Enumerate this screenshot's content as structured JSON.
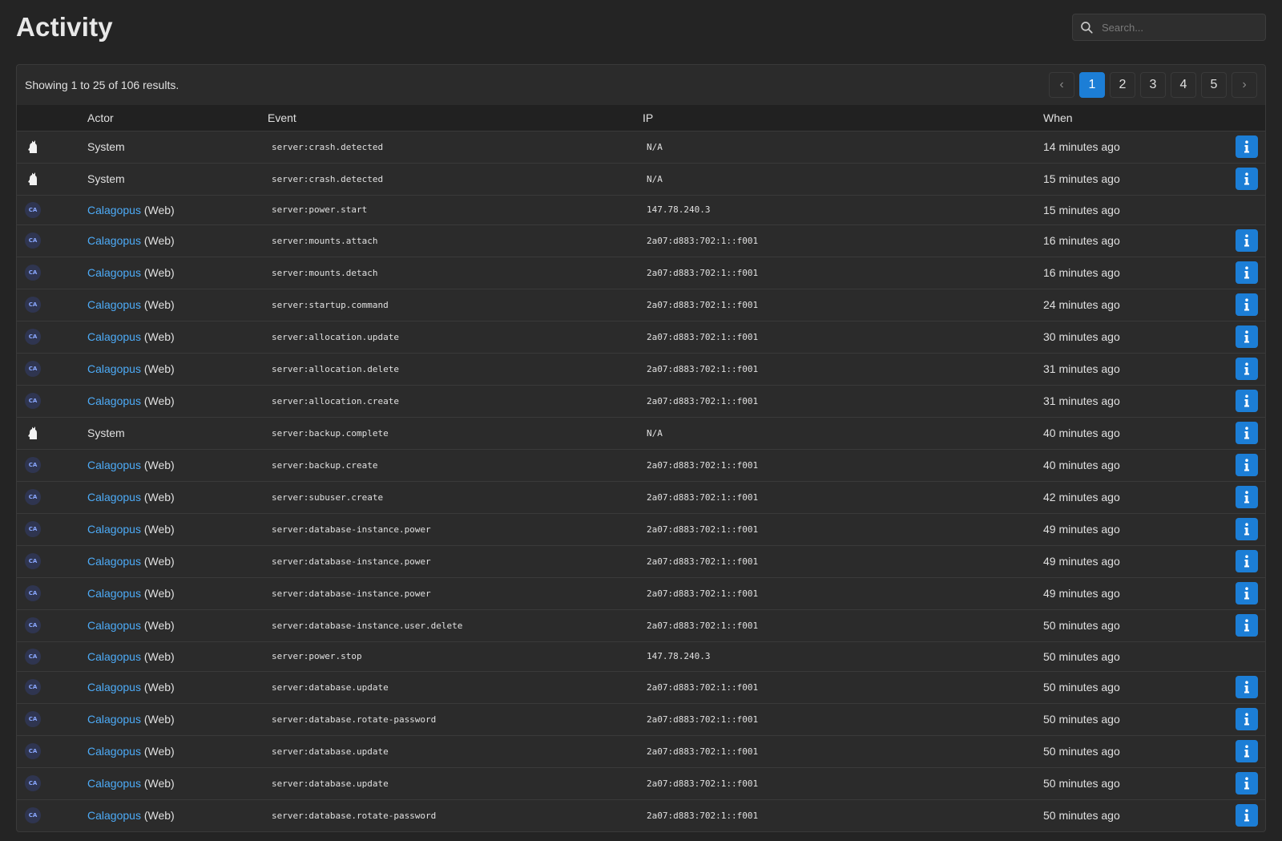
{
  "page": {
    "title": "Activity",
    "search_placeholder": "Search..."
  },
  "results": "Showing 1 to 25 of 106 results.",
  "pagination": {
    "prev": "‹",
    "next": "›",
    "pages": [
      "1",
      "2",
      "3",
      "4",
      "5"
    ],
    "current": "1"
  },
  "columns": [
    "Actor",
    "Event",
    "IP",
    "When"
  ],
  "colors": {
    "background": "#242424",
    "panel": "#2b2b2b",
    "accent": "#1c7ed6",
    "link": "#4dabf7"
  },
  "rows": [
    {
      "kind": "system",
      "actor": "System",
      "event": "server:crash.detected",
      "ip": "N/A",
      "when": "14 minutes ago",
      "info": true
    },
    {
      "kind": "system",
      "actor": "System",
      "event": "server:crash.detected",
      "ip": "N/A",
      "when": "15 minutes ago",
      "info": true
    },
    {
      "kind": "user",
      "avatar": "CA",
      "actor": "Calagopus",
      "suffix": " (Web)",
      "event": "server:power.start",
      "ip": "147.78.240.3",
      "when": "15 minutes ago",
      "info": false
    },
    {
      "kind": "user",
      "avatar": "CA",
      "actor": "Calagopus",
      "suffix": " (Web)",
      "event": "server:mounts.attach",
      "ip": "2a07:d883:702:1::f001",
      "when": "16 minutes ago",
      "info": true
    },
    {
      "kind": "user",
      "avatar": "CA",
      "actor": "Calagopus",
      "suffix": " (Web)",
      "event": "server:mounts.detach",
      "ip": "2a07:d883:702:1::f001",
      "when": "16 minutes ago",
      "info": true
    },
    {
      "kind": "user",
      "avatar": "CA",
      "actor": "Calagopus",
      "suffix": " (Web)",
      "event": "server:startup.command",
      "ip": "2a07:d883:702:1::f001",
      "when": "24 minutes ago",
      "info": true
    },
    {
      "kind": "user",
      "avatar": "CA",
      "actor": "Calagopus",
      "suffix": " (Web)",
      "event": "server:allocation.update",
      "ip": "2a07:d883:702:1::f001",
      "when": "30 minutes ago",
      "info": true
    },
    {
      "kind": "user",
      "avatar": "CA",
      "actor": "Calagopus",
      "suffix": " (Web)",
      "event": "server:allocation.delete",
      "ip": "2a07:d883:702:1::f001",
      "when": "31 minutes ago",
      "info": true
    },
    {
      "kind": "user",
      "avatar": "CA",
      "actor": "Calagopus",
      "suffix": " (Web)",
      "event": "server:allocation.create",
      "ip": "2a07:d883:702:1::f001",
      "when": "31 minutes ago",
      "info": true
    },
    {
      "kind": "system",
      "actor": "System",
      "event": "server:backup.complete",
      "ip": "N/A",
      "when": "40 minutes ago",
      "info": true
    },
    {
      "kind": "user",
      "avatar": "CA",
      "actor": "Calagopus",
      "suffix": " (Web)",
      "event": "server:backup.create",
      "ip": "2a07:d883:702:1::f001",
      "when": "40 minutes ago",
      "info": true
    },
    {
      "kind": "user",
      "avatar": "CA",
      "actor": "Calagopus",
      "suffix": " (Web)",
      "event": "server:subuser.create",
      "ip": "2a07:d883:702:1::f001",
      "when": "42 minutes ago",
      "info": true
    },
    {
      "kind": "user",
      "avatar": "CA",
      "actor": "Calagopus",
      "suffix": " (Web)",
      "event": "server:database-instance.power",
      "ip": "2a07:d883:702:1::f001",
      "when": "49 minutes ago",
      "info": true
    },
    {
      "kind": "user",
      "avatar": "CA",
      "actor": "Calagopus",
      "suffix": " (Web)",
      "event": "server:database-instance.power",
      "ip": "2a07:d883:702:1::f001",
      "when": "49 minutes ago",
      "info": true
    },
    {
      "kind": "user",
      "avatar": "CA",
      "actor": "Calagopus",
      "suffix": " (Web)",
      "event": "server:database-instance.power",
      "ip": "2a07:d883:702:1::f001",
      "when": "49 minutes ago",
      "info": true
    },
    {
      "kind": "user",
      "avatar": "CA",
      "actor": "Calagopus",
      "suffix": " (Web)",
      "event": "server:database-instance.user.delete",
      "ip": "2a07:d883:702:1::f001",
      "when": "50 minutes ago",
      "info": true
    },
    {
      "kind": "user",
      "avatar": "CA",
      "actor": "Calagopus",
      "suffix": " (Web)",
      "event": "server:power.stop",
      "ip": "147.78.240.3",
      "when": "50 minutes ago",
      "info": false
    },
    {
      "kind": "user",
      "avatar": "CA",
      "actor": "Calagopus",
      "suffix": " (Web)",
      "event": "server:database.update",
      "ip": "2a07:d883:702:1::f001",
      "when": "50 minutes ago",
      "info": true
    },
    {
      "kind": "user",
      "avatar": "CA",
      "actor": "Calagopus",
      "suffix": " (Web)",
      "event": "server:database.rotate-password",
      "ip": "2a07:d883:702:1::f001",
      "when": "50 minutes ago",
      "info": true
    },
    {
      "kind": "user",
      "avatar": "CA",
      "actor": "Calagopus",
      "suffix": " (Web)",
      "event": "server:database.update",
      "ip": "2a07:d883:702:1::f001",
      "when": "50 minutes ago",
      "info": true
    },
    {
      "kind": "user",
      "avatar": "CA",
      "actor": "Calagopus",
      "suffix": " (Web)",
      "event": "server:database.update",
      "ip": "2a07:d883:702:1::f001",
      "when": "50 minutes ago",
      "info": true
    },
    {
      "kind": "user",
      "avatar": "CA",
      "actor": "Calagopus",
      "suffix": " (Web)",
      "event": "server:database.rotate-password",
      "ip": "2a07:d883:702:1::f001",
      "when": "50 minutes ago",
      "info": true
    }
  ]
}
